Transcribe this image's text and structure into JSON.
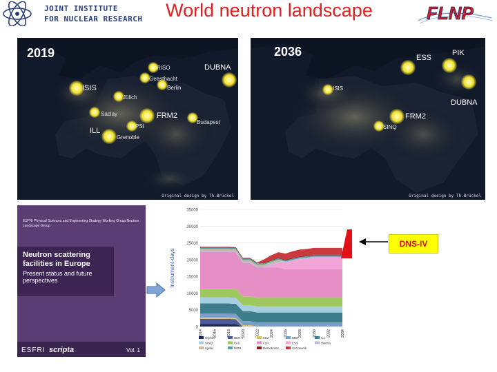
{
  "header": {
    "institute_line1": "JOINT INSTITUTE",
    "institute_line2": "FOR NUCLEAR RESEARCH",
    "title": "World neutron landscape",
    "lab_logo_text": "FLNP"
  },
  "maps": {
    "left": {
      "year": "2019",
      "credit": "Original design by Th.Brückel",
      "sites": [
        {
          "label": "RISO"
        },
        {
          "label": "DUBNA"
        },
        {
          "label": "Geesthacht"
        },
        {
          "label": "Berlin"
        },
        {
          "label": "ISIS"
        },
        {
          "label": "Jülich"
        },
        {
          "label": "Saclay"
        },
        {
          "label": "FRM2"
        },
        {
          "label": "PSI"
        },
        {
          "label": "Budapest"
        },
        {
          "label": "ILL"
        },
        {
          "label": "Grenoble"
        }
      ]
    },
    "right": {
      "year": "2036",
      "credit": "Original design by Th.Brückel",
      "sites": [
        {
          "label": "ESS"
        },
        {
          "label": "PIK"
        },
        {
          "label": "ISIS"
        },
        {
          "label": "DUBNA"
        },
        {
          "label": "FRM2"
        },
        {
          "label": "SINQ"
        }
      ]
    }
  },
  "cover": {
    "header_text": "ESFRI Physical Sciences and Engineering Strategy Working Group Neutron Landscape Group",
    "title": "Neutron scattering facilities in Europe",
    "subtitle": "Present status and future perspectives",
    "footer_left": "ESFRI",
    "footer_brand": "scripta",
    "footer_right": "Vol. 1"
  },
  "chart_data": {
    "type": "area",
    "ylabel": "Instrument-days",
    "ylim": [
      0,
      35000
    ],
    "yticks": [
      "0",
      "5000",
      "10000",
      "15000",
      "20000",
      "25000",
      "30000",
      "35000"
    ],
    "x": [
      "2014",
      "2015",
      "2016",
      "2017",
      "2018",
      "2019",
      "2020",
      "2021",
      "2022",
      "2023",
      "2024",
      "2025",
      "2026",
      "2027",
      "2028",
      "2029",
      "2030",
      "2031",
      "2032",
      "2033",
      "2034"
    ],
    "xtick_labels": [
      "2014",
      "2016",
      "2018",
      "2020",
      "2022",
      "2024",
      "2026",
      "2028",
      "2030",
      "2032",
      "2034"
    ],
    "series": [
      {
        "name": "Orphee",
        "color": "#1f2a5a",
        "values": [
          800,
          800,
          800,
          800,
          800,
          700,
          0,
          0,
          0,
          0,
          0,
          0,
          0,
          0,
          0,
          0,
          0,
          0,
          0,
          0,
          0
        ]
      },
      {
        "name": "BER II",
        "color": "#4a5a9a",
        "values": [
          1500,
          1500,
          1500,
          1500,
          1500,
          1500,
          0,
          0,
          0,
          0,
          0,
          0,
          0,
          0,
          0,
          0,
          0,
          0,
          0,
          0,
          0
        ]
      },
      {
        "name": "KEZ",
        "color": "#d6c36b",
        "values": [
          400,
          400,
          400,
          400,
          400,
          400,
          400,
          400,
          0,
          0,
          0,
          0,
          0,
          0,
          0,
          0,
          0,
          0,
          0,
          0,
          0
        ]
      },
      {
        "name": "BRR",
        "color": "#7aa0c9",
        "values": [
          1200,
          1200,
          1200,
          1200,
          1200,
          1200,
          1200,
          1200,
          1200,
          1200,
          1200,
          1200,
          1200,
          1200,
          1200,
          1200,
          1200,
          1200,
          1200,
          1200,
          1200
        ]
      },
      {
        "name": "ILL",
        "color": "#3e7d8c",
        "values": [
          3000,
          3000,
          3000,
          3000,
          3000,
          3000,
          3000,
          3000,
          3000,
          3000,
          3000,
          3000,
          3000,
          3000,
          3000,
          3000,
          3000,
          3000,
          3000,
          3000,
          3000
        ]
      },
      {
        "name": "SINQ",
        "color": "#a6cde0",
        "values": [
          1800,
          1800,
          1800,
          1800,
          1800,
          1800,
          1800,
          1800,
          1800,
          1800,
          1800,
          1800,
          1800,
          1800,
          1800,
          1800,
          1800,
          1800,
          1800,
          1800,
          1800
        ]
      },
      {
        "name": "ISIS",
        "color": "#9ec85d",
        "values": [
          2600,
          2600,
          2600,
          2600,
          2600,
          2600,
          2600,
          2600,
          2600,
          2600,
          2600,
          2600,
          2600,
          2600,
          2600,
          2600,
          2600,
          2600,
          2600,
          2600,
          2600
        ]
      },
      {
        "name": "FLP",
        "color": "#e58fc6",
        "values": [
          11000,
          11000,
          11000,
          11000,
          11000,
          11000,
          10000,
          10000,
          9000,
          9000,
          9000,
          9000,
          8500,
          8500,
          8500,
          8500,
          8500,
          8500,
          8500,
          8500,
          8500
        ]
      },
      {
        "name": "ESS",
        "color": "#f2a6d7",
        "values": [
          0,
          0,
          0,
          0,
          0,
          0,
          0,
          0,
          0,
          0,
          800,
          1500,
          2000,
          2500,
          3000,
          3200,
          3500,
          3500,
          3500,
          3500,
          3500
        ]
      },
      {
        "name": "Vienna",
        "color": "#b8b8e0",
        "values": [
          300,
          300,
          300,
          300,
          300,
          300,
          300,
          300,
          300,
          300,
          300,
          300,
          300,
          300,
          300,
          300,
          300,
          300,
          300,
          300,
          300
        ]
      },
      {
        "name": "Kjeller",
        "color": "#c8b8a0",
        "values": [
          600,
          600,
          600,
          600,
          600,
          600,
          600,
          600,
          600,
          600,
          600,
          600,
          0,
          0,
          0,
          0,
          0,
          0,
          0,
          0,
          0
        ]
      },
      {
        "name": "MOR",
        "color": "#5aa0a0",
        "values": [
          400,
          400,
          400,
          400,
          400,
          400,
          400,
          400,
          400,
          400,
          400,
          400,
          400,
          400,
          400,
          400,
          400,
          400,
          400,
          400,
          400
        ]
      },
      {
        "name": "Demokritos",
        "color": "#8c1b1b",
        "values": [
          200,
          200,
          200,
          200,
          200,
          200,
          200,
          200,
          200,
          200,
          200,
          200,
          200,
          200,
          200,
          200,
          200,
          200,
          200,
          200,
          200
        ]
      },
      {
        "name": "Szczawnik",
        "color": "#c9393e",
        "values": [
          0,
          0,
          0,
          0,
          0,
          0,
          0,
          0,
          0,
          1000,
          1400,
          1600,
          1800,
          2000,
          2000,
          2000,
          2000,
          2000,
          2000,
          2000,
          2000
        ]
      }
    ],
    "legend_position": "bottom"
  },
  "annotation": {
    "label": "DNS-IV"
  },
  "colors": {
    "title_red": "#e0201f",
    "map_background": "#0d1422",
    "cover_purple": "#5a3d73",
    "annotation_yellow": "#ffff00",
    "annotation_text": "#d0101f"
  }
}
